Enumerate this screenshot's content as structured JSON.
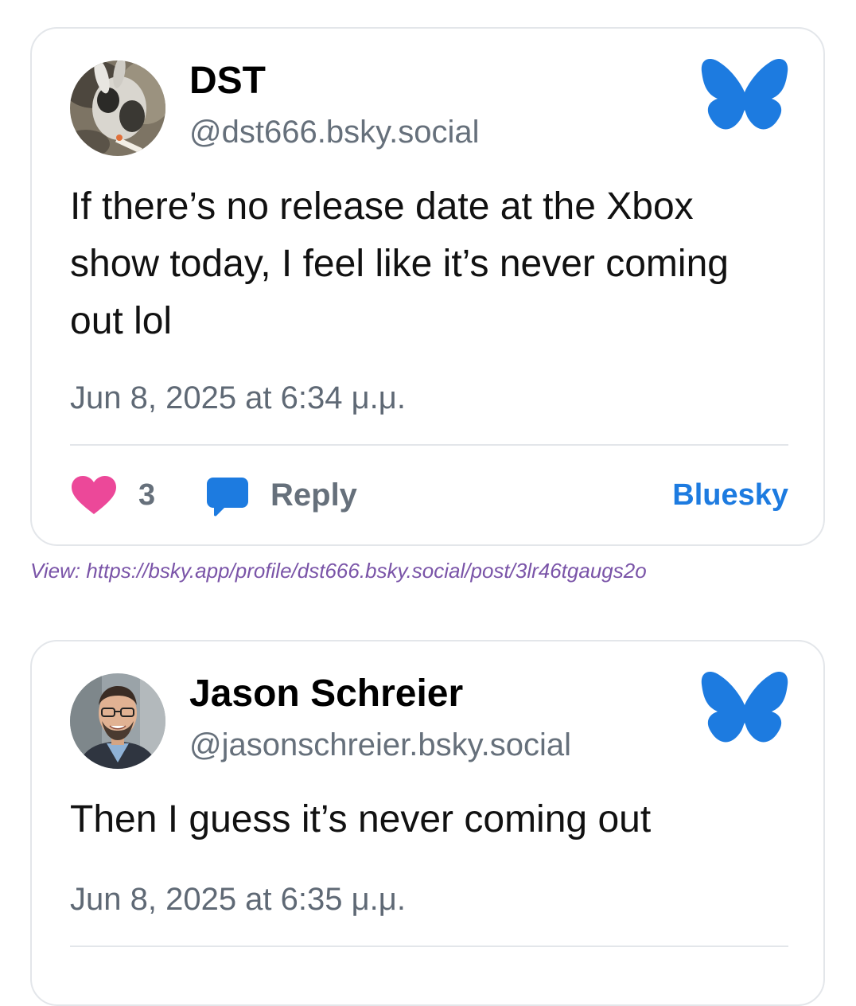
{
  "posts": [
    {
      "display_name": "DST",
      "handle": "@dst666.bsky.social",
      "text": "If there’s no release date at the Xbox show today, I feel like it’s never coming out lol",
      "timestamp": "Jun 8, 2025 at 6:34 μ.μ.",
      "likes": "3",
      "reply_label": "Reply",
      "platform_label": "Bluesky",
      "view_link": "View: https://bsky.app/profile/dst666.bsky.social/post/3lr46tgaugs2o"
    },
    {
      "display_name": "Jason Schreier",
      "handle": "@jasonschreier.bsky.social",
      "text": "Then I guess it’s never coming out",
      "timestamp": "Jun 8, 2025 at 6:35 μ.μ."
    }
  ],
  "icons": {
    "logo": "bluesky-butterfly-icon",
    "like": "heart-icon",
    "reply": "speech-bubble-icon"
  },
  "colors": {
    "brand_blue": "#1d7be0",
    "like_pink": "#ec4899",
    "link_purple": "#7a54a8"
  }
}
